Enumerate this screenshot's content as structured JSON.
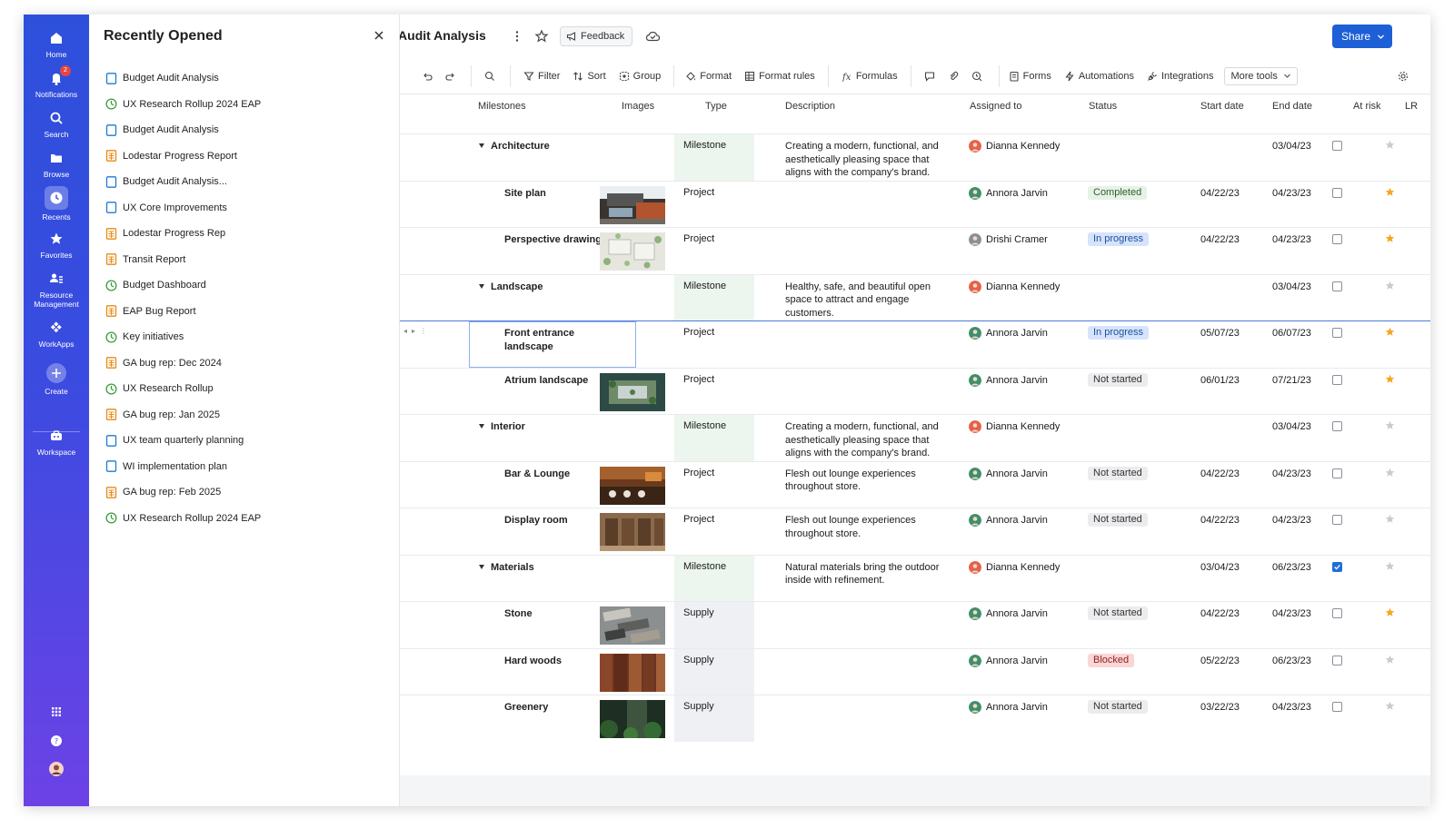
{
  "rail": {
    "items": [
      {
        "label": "Home",
        "icon": "home-icon"
      },
      {
        "label": "Notifications",
        "icon": "bell-icon",
        "badge": "2"
      },
      {
        "label": "Search",
        "icon": "search-icon"
      },
      {
        "label": "Browse",
        "icon": "folder-icon"
      },
      {
        "label": "Recents",
        "icon": "clock-icon"
      },
      {
        "label": "Favorites",
        "icon": "star-icon"
      },
      {
        "label": "Resource Management",
        "icon": "people-icon"
      },
      {
        "label": "WorkApps",
        "icon": "workapps-icon"
      },
      {
        "label": "Create",
        "icon": "plus-icon"
      },
      {
        "label": "Workspace",
        "icon": "workspace-icon"
      }
    ]
  },
  "recent": {
    "title": "Recently Opened",
    "items": [
      {
        "label": "Budget Audit Analysis",
        "kind": "sheet"
      },
      {
        "label": "UX Research Rollup 2024 EAP",
        "kind": "dashboard"
      },
      {
        "label": "Budget Audit Analysis",
        "kind": "sheet"
      },
      {
        "label": "Lodestar Progress Report",
        "kind": "report"
      },
      {
        "label": "Budget Audit Analysis...",
        "kind": "sheet"
      },
      {
        "label": "UX Core Improvements",
        "kind": "sheet"
      },
      {
        "label": "Lodestar Progress Rep",
        "kind": "report"
      },
      {
        "label": "Transit Report",
        "kind": "report"
      },
      {
        "label": "Budget Dashboard",
        "kind": "dashboard"
      },
      {
        "label": "EAP Bug Report",
        "kind": "report"
      },
      {
        "label": "Key initiatives",
        "kind": "dashboard"
      },
      {
        "label": "GA bug rep: Dec 2024",
        "kind": "report"
      },
      {
        "label": "UX Research Rollup",
        "kind": "dashboard"
      },
      {
        "label": "GA bug rep: Jan 2025",
        "kind": "report"
      },
      {
        "label": "UX team quarterly planning",
        "kind": "sheet"
      },
      {
        "label": "WI implementation plan",
        "kind": "sheet"
      },
      {
        "label": "GA bug rep: Feb 2025",
        "kind": "report"
      },
      {
        "label": "UX Research Rollup 2024 EAP",
        "kind": "dashboard"
      }
    ]
  },
  "header": {
    "title": "t Audit Analysis",
    "feedback": "Feedback",
    "share": "Share"
  },
  "toolbar": {
    "filter": "Filter",
    "sort": "Sort",
    "group": "Group",
    "format": "Format",
    "format_rules": "Format rules",
    "formulas": "Formulas",
    "forms": "Forms",
    "automations": "Automations",
    "integrations": "Integrations",
    "more_tools": "More tools"
  },
  "columns": {
    "milestones": "Milestones",
    "images": "Images",
    "type": "Type",
    "description": "Description",
    "assigned": "Assigned to",
    "status": "Status",
    "start": "Start date",
    "end": "End date",
    "at_risk": "At risk",
    "lr": "LR"
  },
  "rows": [
    {
      "name": "Architecture",
      "level": 0,
      "type": "Milestone",
      "description": "Creating a modern, functional, and aesthetically pleasing space that aligns with the company's brand.",
      "assigned": "Dianna Kennedy",
      "status": "",
      "start": "",
      "end": "03/04/23",
      "at_risk": false,
      "starred": false,
      "image": ""
    },
    {
      "name": "Site plan",
      "level": 1,
      "type": "Project",
      "description": "",
      "assigned": "Annora Jarvin",
      "status": "Completed",
      "start": "04/22/23",
      "end": "04/23/23",
      "at_risk": false,
      "starred": true,
      "image": "building"
    },
    {
      "name": "Perspective drawing",
      "level": 1,
      "type": "Project",
      "description": "",
      "assigned": "Drishi Cramer",
      "status": "In progress",
      "start": "04/22/23",
      "end": "04/23/23",
      "at_risk": false,
      "starred": true,
      "image": "plan"
    },
    {
      "name": "Landscape",
      "level": 0,
      "type": "Milestone",
      "description": "Healthy, safe, and beautiful open space to attract and engage customers.",
      "assigned": "Dianna Kennedy",
      "status": "",
      "start": "",
      "end": "03/04/23",
      "at_risk": false,
      "starred": false,
      "image": ""
    },
    {
      "name": "Front entrance landscape",
      "level": 1,
      "type": "Project",
      "description": "",
      "assigned": "Annora Jarvin",
      "status": "In progress",
      "start": "05/07/23",
      "end": "06/07/23",
      "at_risk": false,
      "starred": true,
      "image": "",
      "selected": true
    },
    {
      "name": "Atrium landscape",
      "level": 1,
      "type": "Project",
      "description": "",
      "assigned": "Annora Jarvin",
      "status": "Not started",
      "start": "06/01/23",
      "end": "07/21/23",
      "at_risk": false,
      "starred": true,
      "image": "atrium"
    },
    {
      "name": "Interior",
      "level": 0,
      "type": "Milestone",
      "description": "Creating a modern, functional, and aesthetically pleasing space that aligns with the company's brand.",
      "assigned": "Dianna Kennedy",
      "status": "",
      "start": "",
      "end": "03/04/23",
      "at_risk": false,
      "starred": false,
      "image": ""
    },
    {
      "name": "Bar & Lounge",
      "level": 1,
      "type": "Project",
      "description": "Flesh out lounge experiences throughout store.",
      "assigned": "Annora Jarvin",
      "status": "Not started",
      "start": "04/22/23",
      "end": "04/23/23",
      "at_risk": false,
      "starred": false,
      "image": "bar"
    },
    {
      "name": "Display room",
      "level": 1,
      "type": "Project",
      "description": "Flesh out lounge experiences throughout store.",
      "assigned": "Annora Jarvin",
      "status": "Not started",
      "start": "04/22/23",
      "end": "04/23/23",
      "at_risk": false,
      "starred": false,
      "image": "display"
    },
    {
      "name": "Materials",
      "level": 0,
      "type": "Milestone",
      "description": "Natural materials bring the outdoor inside with refinement.",
      "assigned": "Dianna Kennedy",
      "status": "",
      "start": "03/04/23",
      "end": "06/23/23",
      "at_risk": true,
      "starred": false,
      "image": ""
    },
    {
      "name": "Stone",
      "level": 1,
      "type": "Supply",
      "description": "",
      "assigned": "Annora Jarvin",
      "status": "Not started",
      "start": "04/22/23",
      "end": "04/23/23",
      "at_risk": false,
      "starred": true,
      "image": "stone"
    },
    {
      "name": "Hard woods",
      "level": 1,
      "type": "Supply",
      "description": "",
      "assigned": "Annora Jarvin",
      "status": "Blocked",
      "start": "05/22/23",
      "end": "06/23/23",
      "at_risk": false,
      "starred": false,
      "image": "wood"
    },
    {
      "name": "Greenery",
      "level": 1,
      "type": "Supply",
      "description": "",
      "assigned": "Annora Jarvin",
      "status": "Not started",
      "start": "03/22/23",
      "end": "04/23/23",
      "at_risk": false,
      "starred": false,
      "image": "greenery"
    }
  ],
  "colors": {
    "accent": "#1d5fd6",
    "star": "#f5a623",
    "star_off": "#c8cbd0"
  }
}
